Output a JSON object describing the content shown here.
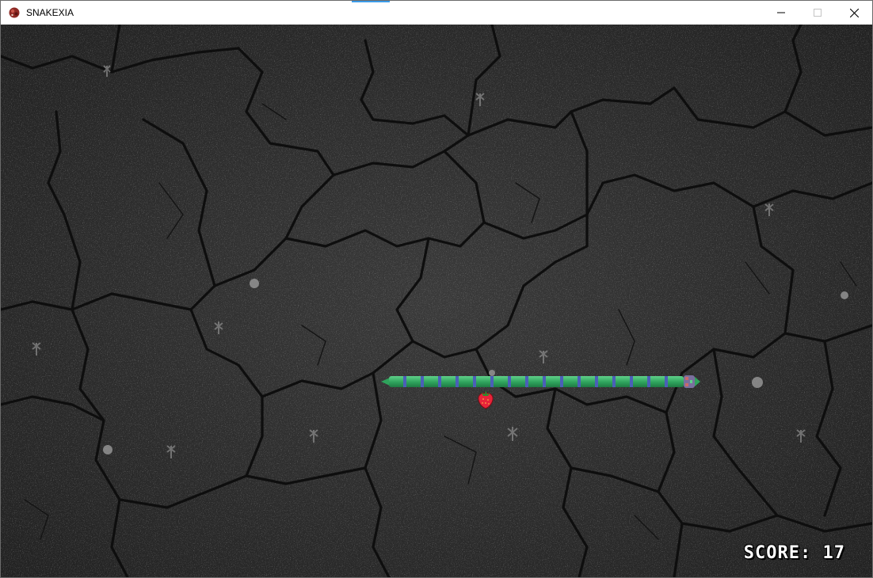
{
  "window": {
    "title": "SNAKEXIA",
    "app_icon": "snake-app-icon",
    "controls": {
      "minimize_icon": "minimize-icon",
      "maximize_icon": "maximize-icon",
      "close_icon": "close-icon"
    }
  },
  "game": {
    "background": "cracked-earth-ground",
    "snake": {
      "direction": "right",
      "body_color": "#2fa35c",
      "stripe_color": "#4b5fb8",
      "head_color": "#7a6f9e"
    },
    "food": {
      "kind": "strawberry",
      "icon": "strawberry-icon",
      "color": "#e8243a"
    },
    "score_label": "SCORE: 17"
  }
}
